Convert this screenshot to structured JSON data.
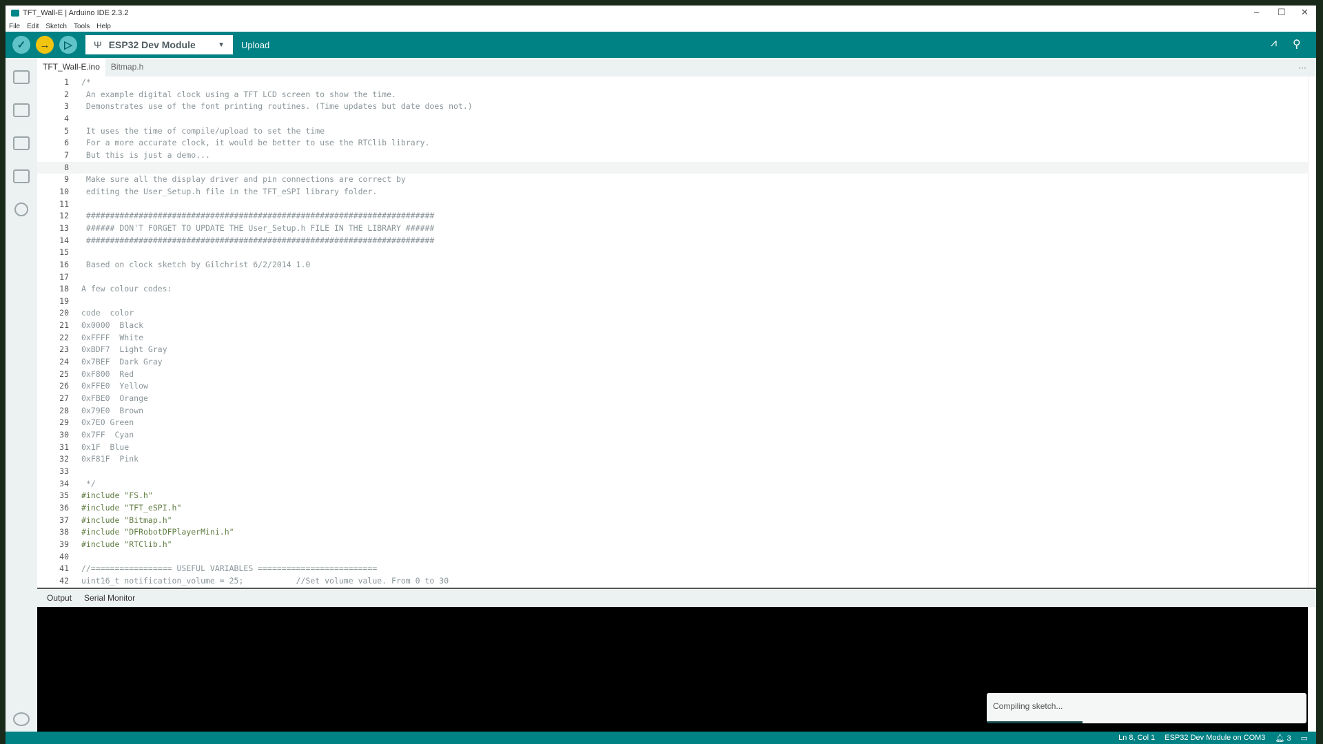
{
  "window": {
    "title": "TFT_Wall-E | Arduino IDE 2.3.2"
  },
  "menu": [
    "File",
    "Edit",
    "Sketch",
    "Tools",
    "Help"
  ],
  "toolbar": {
    "board": "ESP32 Dev Module",
    "hover_label": "Upload"
  },
  "tabs": [
    "TFT_Wall-E.ino",
    "Bitmap.h"
  ],
  "editor": {
    "current_line": 8,
    "lines": [
      "/*",
      " An example digital clock using a TFT LCD screen to show the time.",
      " Demonstrates use of the font printing routines. (Time updates but date does not.)",
      "",
      " It uses the time of compile/upload to set the time",
      " For a more accurate clock, it would be better to use the RTClib library.",
      " But this is just a demo...",
      "",
      " Make sure all the display driver and pin connections are correct by",
      " editing the User_Setup.h file in the TFT_eSPI library folder.",
      "",
      " #########################################################################",
      " ###### DON'T FORGET TO UPDATE THE User_Setup.h FILE IN THE LIBRARY ######",
      " #########################################################################",
      "",
      " Based on clock sketch by Gilchrist 6/2/2014 1.0",
      "",
      "A few colour codes:",
      "",
      "code  color",
      "0x0000  Black",
      "0xFFFF  White",
      "0xBDF7  Light Gray",
      "0x7BEF  Dark Gray",
      "0xF800  Red",
      "0xFFE0  Yellow",
      "0xFBE0  Orange",
      "0x79E0  Brown",
      "0x7E0 Green",
      "0x7FF  Cyan",
      "0x1F  Blue",
      "0xF81F  Pink",
      "",
      " */",
      "#include \"FS.h\"",
      "#include \"TFT_eSPI.h\"",
      "#include \"Bitmap.h\"",
      "#include \"DFRobotDFPlayerMini.h\"",
      "#include \"RTClib.h\"",
      "",
      "//================= USEFUL VARIABLES =========================",
      "uint16_t notification_volume = 25;           //Set volume value. From 0 to 30"
    ]
  },
  "output_tabs": [
    "Output",
    "Serial Monitor"
  ],
  "toast": {
    "message": "Compiling sketch...",
    "progress_percent": 30
  },
  "status": {
    "position": "Ln 8, Col 1",
    "board_port": "ESP32 Dev Module on COM3",
    "notifications": "3"
  },
  "colors": {
    "accent": "#008184",
    "upload_hover": "#f1c40f"
  }
}
